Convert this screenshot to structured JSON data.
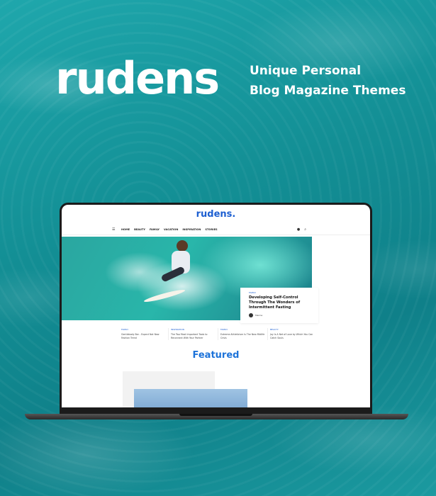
{
  "promo": {
    "brand": "rudens",
    "tagline_line1": "Unique Personal",
    "tagline_line2": "Blog Magazine Themes"
  },
  "site": {
    "logo": "rudens.",
    "nav": [
      "HOME",
      "BEAUTY",
      "FAMILY",
      "VACATION",
      "INSPIRATION",
      "STORIES"
    ],
    "icons": [
      "menu-icon",
      "user-icon",
      "search-icon"
    ]
  },
  "hero_post": {
    "category": "FAMILY",
    "title": "Developing Self-Control Through The Wonders of Intermittent Fasting",
    "author": "Marina"
  },
  "posts": [
    {
      "category": "FAMILY",
      "title": "Gentlebody Bar - Expect Not New Fashion Trend"
    },
    {
      "category": "INSPIRATION",
      "title": "The Two Most Important Tools to Reconnect With Your Partner"
    },
    {
      "category": "FAMILY",
      "title": "Extreme Athleticism Is The New Midlife Crisis"
    },
    {
      "category": "BEAUTY",
      "title": "Joy Is A Net of Love by Which You Can Catch Souls"
    }
  ],
  "featured_heading": "Featured",
  "colors": {
    "accent": "#1d5fd1",
    "featured": "#1d73d9",
    "ocean": "#149199"
  }
}
